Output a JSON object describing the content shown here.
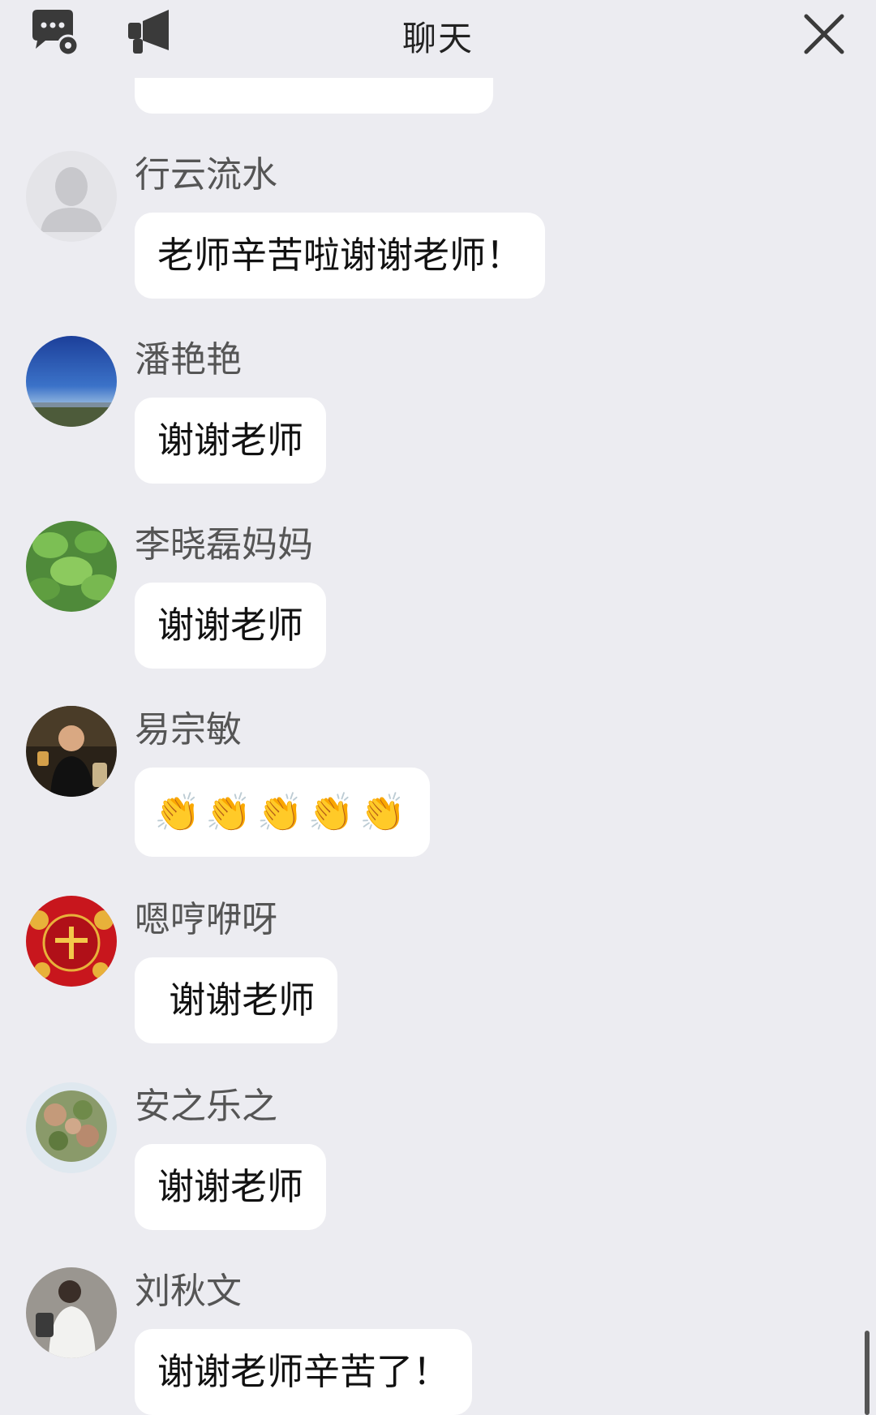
{
  "header": {
    "title": "聊天",
    "icons": [
      "chat-settings-icon",
      "megaphone-icon",
      "close-icon"
    ]
  },
  "partial_message": {
    "emojis": [
      "👏",
      "👏",
      "👏",
      "👏",
      "👏",
      "👏"
    ]
  },
  "messages": [
    {
      "name": "行云流水",
      "text": "老师辛苦啦谢谢老师！",
      "avatar": "default-avatar"
    },
    {
      "name": "潘艳艳",
      "text": "谢谢老师",
      "avatar": "sky-landscape-avatar"
    },
    {
      "name": "李晓磊妈妈",
      "text": "谢谢老师",
      "avatar": "green-leaves-avatar"
    },
    {
      "name": "易宗敏",
      "text": "👏👏👏👏👏",
      "avatar": "man-photo-avatar"
    },
    {
      "name": "嗯哼咿呀",
      "text": " 谢谢老师",
      "avatar": "red-zhao-avatar"
    },
    {
      "name": "安之乐之",
      "text": "谢谢老师",
      "avatar": "tree-avatar"
    },
    {
      "name": "刘秋文",
      "text": "谢谢老师辛苦了！",
      "avatar": "person-photo-avatar"
    }
  ],
  "colors": {
    "background": "#ececf1",
    "bubble": "#ffffff",
    "icon": "#3a3a3a"
  }
}
